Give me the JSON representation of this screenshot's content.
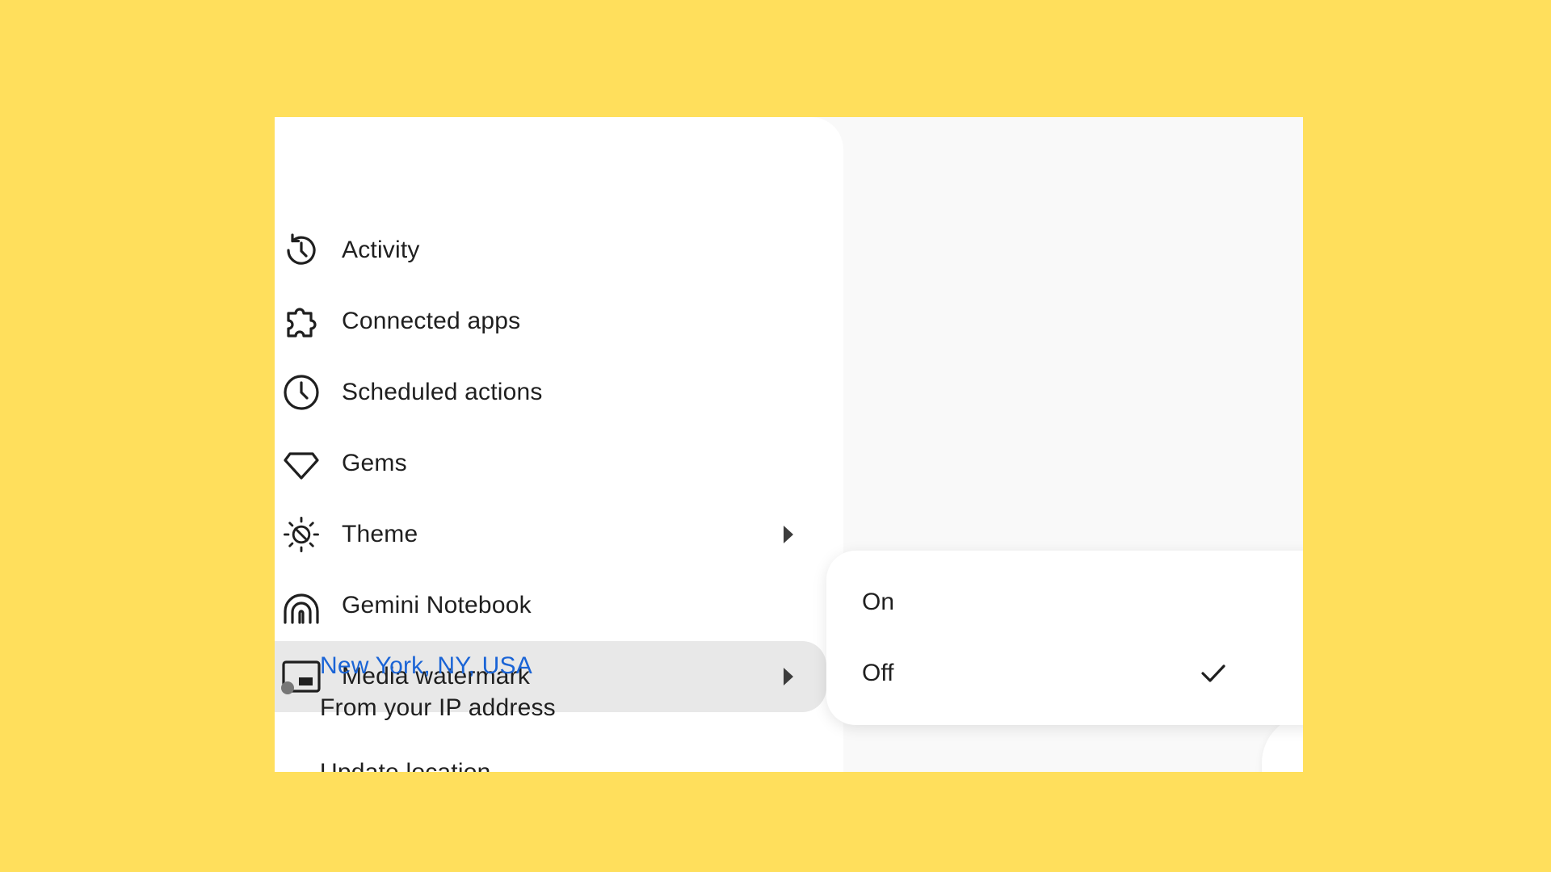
{
  "menu": {
    "items": [
      {
        "label": "Activity",
        "icon": "history-icon"
      },
      {
        "label": "Connected apps",
        "icon": "puzzle-icon"
      },
      {
        "label": "Scheduled actions",
        "icon": "clock-icon"
      },
      {
        "label": "Gems",
        "icon": "gem-icon"
      },
      {
        "label": "Theme",
        "icon": "theme-icon",
        "has_submenu": true
      },
      {
        "label": "Gemini Notebook",
        "icon": "notebook-icon"
      },
      {
        "label": "Media watermark",
        "icon": "watermark-icon",
        "has_submenu": true,
        "active": true
      }
    ],
    "location": {
      "city": "New York, NY, USA",
      "source": "From your IP address",
      "update": "Update location"
    }
  },
  "submenu": {
    "options": [
      {
        "label": "On",
        "selected": false
      },
      {
        "label": "Off",
        "selected": true
      }
    ]
  },
  "colors": {
    "background": "#FFDF5C",
    "active_item": "#E8E8E8",
    "link": "#1A64D6",
    "text": "#1F1F1F"
  }
}
